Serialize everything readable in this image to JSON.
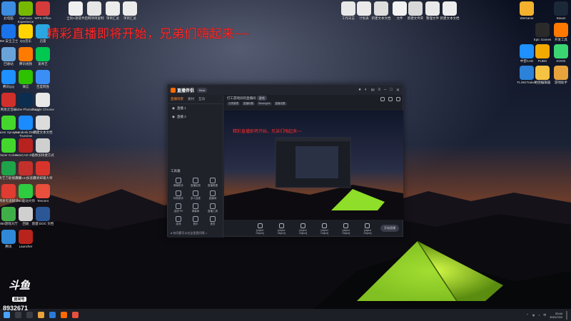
{
  "overlay_banner": "精彩直播即将开始，兄弟们嗨起来~~",
  "watermark": {
    "logo": "斗鱼",
    "sub": "房间号",
    "room_id": "8932671"
  },
  "desktop_left_icons": [
    {
      "label": "此电脑",
      "color": "#3c8ce0"
    },
    {
      "label": "GeForce Experience",
      "color": "#76b900"
    },
    {
      "label": "WPS Office",
      "color": "#d63b3b"
    },
    {
      "label": "360 安全卫士",
      "color": "#1a73e8"
    },
    {
      "label": "QQ音乐",
      "color": "#ffd400"
    },
    {
      "label": "迅雷",
      "color": "#2aa7e0"
    },
    {
      "label": "回收站",
      "color": "#6aa3d8"
    },
    {
      "label": "腾讯视频",
      "color": "#ff7a00"
    },
    {
      "label": "爱奇艺",
      "color": "#00c851"
    },
    {
      "label": "腾讯QQ",
      "color": "#1e90ff"
    },
    {
      "label": "微信",
      "color": "#2dc100"
    },
    {
      "label": "百度网盘",
      "color": "#3a8ef6"
    },
    {
      "label": "网易云音乐",
      "color": "#d0302c"
    },
    {
      "label": "Adobe Photoshop",
      "color": "#0b2d4f"
    },
    {
      "label": "Google Chrome",
      "color": "#e8e8e8"
    },
    {
      "label": "Razer Synapse",
      "color": "#44d62c"
    },
    {
      "label": "Autodesk DWG Trueview",
      "color": "#1a8cff"
    },
    {
      "label": "新建文本文档",
      "color": "#dcdcdc"
    },
    {
      "label": "Razer Cortex",
      "color": "#44d62c"
    },
    {
      "label": "AutoCAD 2007",
      "color": "#b8221e"
    },
    {
      "label": "已添加快捷方式",
      "color": "#cfcfcf"
    },
    {
      "label": "爱奇艺万能播放器",
      "color": "#1fa34a"
    },
    {
      "label": "网易UU加速器",
      "color": "#c4302b"
    },
    {
      "label": "网易邮箱大师",
      "color": "#d9342b"
    },
    {
      "label": "网易有道翻译",
      "color": "#e03c31"
    },
    {
      "label": "360驱动大师",
      "color": "#2ecc40"
    },
    {
      "label": "Tencent",
      "color": "#e84f3d"
    },
    {
      "label": "360游戏大厅",
      "color": "#3fae49"
    },
    {
      "label": "回收",
      "color": "#d0d0d0"
    },
    {
      "label": "新建 DOC 文档",
      "color": "#2b5797"
    },
    {
      "label": "腾讯",
      "color": "#2f89d8"
    },
    {
      "label": "Launcher",
      "color": "#b8241c"
    }
  ],
  "desktop_top_icons": [
    {
      "label": "全民K歌软件",
      "color": "#f0f0f0"
    },
    {
      "label": "后网项目复制",
      "color": "#e6e6e6"
    },
    {
      "label": "项目汇总",
      "color": "#ececec"
    },
    {
      "label": "项目汇总",
      "color": "#ececec"
    },
    {
      "label": "工作日志",
      "color": "#e8e8e8"
    },
    {
      "label": "计划表",
      "color": "#eaeaea"
    },
    {
      "label": "新建文本文档",
      "color": "#dedede"
    },
    {
      "label": "文件",
      "color": "#f2f2f2"
    },
    {
      "label": "新建文件夹",
      "color": "#d8d8d8"
    },
    {
      "label": "整理文件",
      "color": "#e9e9e9"
    },
    {
      "label": "新建文本文档",
      "color": "#ededed"
    }
  ],
  "desktop_right_icons": [
    {
      "label": "WeGame",
      "color": "#f3b12d"
    },
    {
      "label": "Steam",
      "color": "#1b2838"
    },
    {
      "label": "Epic Games",
      "color": "#2a2a2a"
    },
    {
      "label": "开发工具",
      "color": "#ff7800"
    },
    {
      "label": "中望CAD",
      "color": "#1e90ff"
    },
    {
      "label": "PUBG",
      "color": "#f2a900"
    },
    {
      "label": "KOOK",
      "color": "#3bd672"
    },
    {
      "label": "FLiNGTrainer",
      "color": "#2b82d8"
    },
    {
      "label": "地图编辑器",
      "color": "#f5c242"
    },
    {
      "label": "游戏助手",
      "color": "#e8a33d"
    }
  ],
  "app_window": {
    "logo": "直播伴侣",
    "version_chip": "Beta",
    "tabs": [
      "直播场景",
      "素材",
      "互动"
    ],
    "scenes": [
      "直播 1",
      "直播 2"
    ],
    "tools_title": "工具箱",
    "tools": [
      {
        "label": "弹幕助手"
      },
      {
        "label": "直播回放"
      },
      {
        "label": "直播数据"
      },
      {
        "label": "特效助手"
      },
      {
        "label": "多人连麦"
      },
      {
        "label": "直播间"
      },
      {
        "label": "连线 PK"
      },
      {
        "label": "弹幕库"
      },
      {
        "label": "直播工具"
      },
      {
        "label": "游戏"
      },
      {
        "label": "音乐"
      },
      {
        "label": "更多"
      }
    ],
    "footer_note": "● 有问题可以在这里提问哦 >",
    "title": "打工游戏间的直播间",
    "title_chip": "游戏",
    "sub_tags": [
      "分类管理",
      "直播标题",
      "Steamgirls",
      "直播设置"
    ],
    "preview_banner": "精彩直播即将开始，兄弟们嗨起来~~",
    "controls": [
      {
        "label": "直播间"
      },
      {
        "label": "摄像头"
      },
      {
        "label": "设置"
      },
      {
        "label": "画中画"
      },
      {
        "label": "麦克风"
      },
      {
        "label": "扬声器"
      }
    ],
    "go_live": "开始直播"
  },
  "taskbar": {
    "clock_time": "20:44",
    "clock_date": "2021/7/22",
    "tray_lang": "中"
  }
}
